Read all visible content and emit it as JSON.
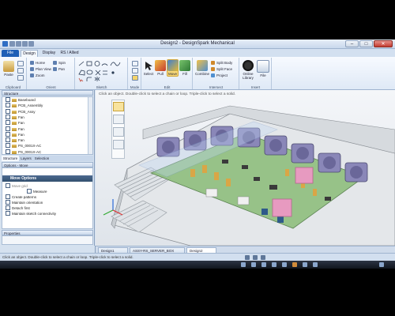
{
  "window": {
    "title": "Design2 - DesignSpark Mechanical"
  },
  "window_controls": {
    "minimize": "–",
    "maximize": "□",
    "close": "✕"
  },
  "ribbon_tabs": [
    "File",
    "Design",
    "Display",
    "RS / Allied"
  ],
  "ribbon": {
    "clipboard": {
      "label": "Clipboard",
      "paste": "Paste"
    },
    "orient": {
      "label": "Orient",
      "home": "Home",
      "spin": "Spin",
      "plan_view": "Plan View",
      "pan": "Pan",
      "zoom": "Zoom"
    },
    "sketch": {
      "label": "Sketch"
    },
    "mode": {
      "label": "Mode"
    },
    "edit": {
      "label": "Edit",
      "select": "Select",
      "pull": "Pull",
      "move": "Move",
      "fill": "Fill"
    },
    "intersect": {
      "label": "Intersect",
      "combine": "Combine",
      "split_body": "Split Body",
      "split_face": "Split Face",
      "project": "Project"
    },
    "insert": {
      "label": "Insert",
      "online_library": "Online Library",
      "file": "File"
    }
  },
  "structure": {
    "header": "Structure",
    "items": [
      "Baseboard",
      "PCB_Assembly",
      "PCB_Assy",
      "Fan",
      "Fan",
      "Fan",
      "Fan",
      "Fan",
      "PS_0001X-AC",
      "PS_0001X-AC"
    ]
  },
  "panel_tabs": [
    "Structure",
    "Layers",
    "Selection"
  ],
  "options": {
    "header": "Options - Move",
    "title": "Move Options",
    "rows": [
      "Move grid",
      "Measure",
      "Create patterns",
      "Maintain orientation",
      "Detach first",
      "Maintain sketch connectivity"
    ]
  },
  "properties": {
    "header": "Properties"
  },
  "viewport": {
    "hint": "Click an object.  Double-click to select a chain or loop.  Triple-click to select a solid."
  },
  "document_tabs": [
    "Design1",
    "ASSY-RS_SERVER_BOX",
    "Design2"
  ],
  "status": {
    "text": "Click an object.  Double-click to select a chain or loop.  Triple-click to select a solid."
  },
  "colors": {
    "ribbon": "#dfe9f6",
    "file_tab": "#1f5fb6",
    "pcb": "#8fbf7e",
    "fans": "#8a87b8",
    "pink_component": "#e79ac0"
  }
}
